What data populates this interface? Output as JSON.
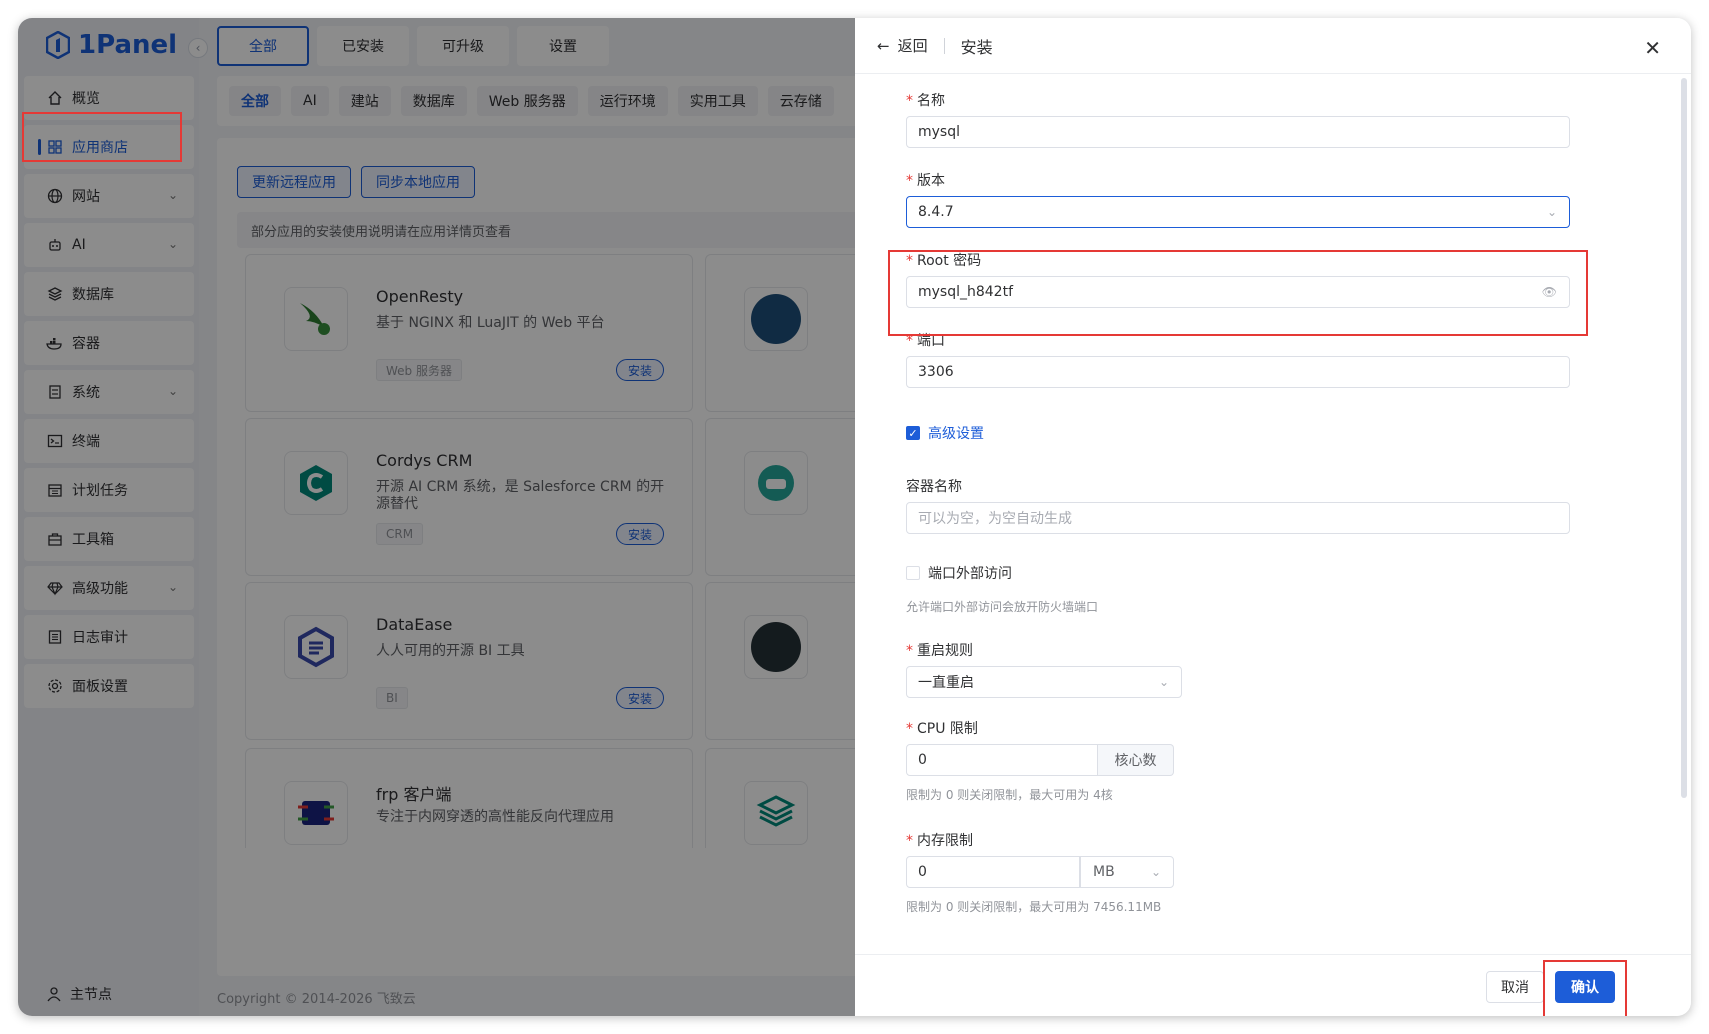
{
  "logo": {
    "text": "1Panel"
  },
  "sidebar": {
    "items": [
      {
        "label": "概览",
        "icon": "home-icon"
      },
      {
        "label": "应用商店",
        "icon": "grid-icon",
        "active": true
      },
      {
        "label": "网站",
        "icon": "globe-icon",
        "expandable": true
      },
      {
        "label": "AI",
        "icon": "robot-icon",
        "expandable": true
      },
      {
        "label": "数据库",
        "icon": "layers-icon"
      },
      {
        "label": "容器",
        "icon": "docker-icon"
      },
      {
        "label": "系统",
        "icon": "server-icon",
        "expandable": true
      },
      {
        "label": "终端",
        "icon": "terminal-icon"
      },
      {
        "label": "计划任务",
        "icon": "calendar-icon"
      },
      {
        "label": "工具箱",
        "icon": "toolbox-icon"
      },
      {
        "label": "高级功能",
        "icon": "diamond-icon",
        "expandable": true
      },
      {
        "label": "日志审计",
        "icon": "log-icon"
      },
      {
        "label": "面板设置",
        "icon": "gear-icon"
      }
    ],
    "node_label": "主节点"
  },
  "top_tabs": [
    "全部",
    "已安装",
    "可升级",
    "设置"
  ],
  "categories": [
    "全部",
    "AI",
    "建站",
    "数据库",
    "Web 服务器",
    "运行环境",
    "实用工具",
    "云存储"
  ],
  "buttons": {
    "update_remote": "更新远程应用",
    "sync_local": "同步本地应用"
  },
  "tip": "部分应用的安装使用说明请在应用详情页查看",
  "apps": [
    {
      "name": "OpenResty",
      "desc": "基于 NGINX 和 LuaJIT 的 Web 平台",
      "tag": "Web 服务器",
      "install": "安装"
    },
    {
      "name": "Cordys CRM",
      "desc": "开源 AI CRM 系统，是 Salesforce CRM 的开源替代",
      "tag": "CRM",
      "install": "安装"
    },
    {
      "name": "DataEase",
      "desc": "人人可用的开源 BI 工具",
      "tag": "BI",
      "install": "安装"
    },
    {
      "name": "frp 客户端",
      "desc": "专注于内网穿透的高性能反向代理应用",
      "tag": "",
      "install": ""
    }
  ],
  "copyright": "Copyright © 2014-2026 飞致云",
  "drawer": {
    "back": "返回",
    "title": "安装",
    "fields": {
      "name_label": "名称",
      "name_value": "mysql",
      "version_label": "版本",
      "version_value": "8.4.7",
      "root_password_label": "Root 密码",
      "root_password_value": "mysql_h842tf",
      "port_label": "端口",
      "port_value": "3306",
      "advanced_label": "高级设置",
      "container_name_label": "容器名称",
      "container_name_placeholder": "可以为空，为空自动生成",
      "port_external_label": "端口外部访问",
      "port_external_hint": "允许端口外部访问会放开防火墙端口",
      "restart_label": "重启规则",
      "restart_value": "一直重启",
      "cpu_label": "CPU 限制",
      "cpu_value": "0",
      "cpu_unit": "核心数",
      "cpu_hint": "限制为 0 则关闭限制，最大可用为 4核",
      "memory_label": "内存限制",
      "memory_value": "0",
      "memory_unit": "MB",
      "memory_hint": "限制为 0 则关闭限制，最大可用为 7456.11MB"
    },
    "cancel": "取消",
    "confirm": "确认"
  },
  "colors": {
    "accent": "#1d5dd8",
    "highlight": "#e53935"
  }
}
